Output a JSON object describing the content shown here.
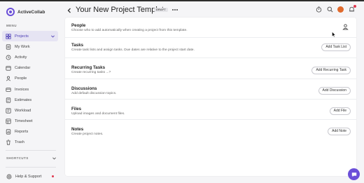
{
  "app": {
    "brand": "ActiveCollab"
  },
  "sidebar": {
    "menu_label": "MENU",
    "items": [
      {
        "label": "Projects",
        "icon": "projects-icon",
        "active": true
      },
      {
        "label": "My Work",
        "icon": "my-work-icon"
      },
      {
        "label": "Activity",
        "icon": "activity-icon"
      },
      {
        "label": "Calendar",
        "icon": "calendar-icon"
      },
      {
        "label": "People",
        "icon": "people-icon"
      },
      {
        "label": "Invoices",
        "icon": "invoices-icon"
      },
      {
        "label": "Estimates",
        "icon": "estimates-icon"
      },
      {
        "label": "Workload",
        "icon": "workload-icon"
      },
      {
        "label": "Timesheet",
        "icon": "timesheet-icon"
      },
      {
        "label": "Reports",
        "icon": "reports-icon"
      },
      {
        "label": "Trash",
        "icon": "trash-icon"
      }
    ],
    "shortcuts_label": "SHORTCUTS",
    "help_label": "Help & Support"
  },
  "header": {
    "title": "Your New Project Template",
    "badge": "DRAFT"
  },
  "sections": {
    "people": {
      "title": "People",
      "desc": "Choose who to add automatically when creating a project from this template."
    },
    "tasks": {
      "title": "Tasks",
      "desc": "Create task lists and assign tasks. Due dates are relative to the project start date.",
      "button": "Add Task List"
    },
    "recurring": {
      "title": "Recurring Tasks",
      "desc": "Create recurring tasks ...?",
      "button": "Add Recurring Task"
    },
    "discussions": {
      "title": "Discussions",
      "desc": "Add default discussion topics.",
      "button": "Add Discussion"
    },
    "files": {
      "title": "Files",
      "desc": "Upload images and document files.",
      "button": "Add File"
    },
    "notes": {
      "title": "Notes",
      "desc": "Create project notes.",
      "button": "Add Note"
    }
  },
  "colors": {
    "accent": "#6b4fd8",
    "active_bg": "#e6e4f3",
    "badge_red": "#e0384f",
    "avatar": "#e06a2c"
  }
}
